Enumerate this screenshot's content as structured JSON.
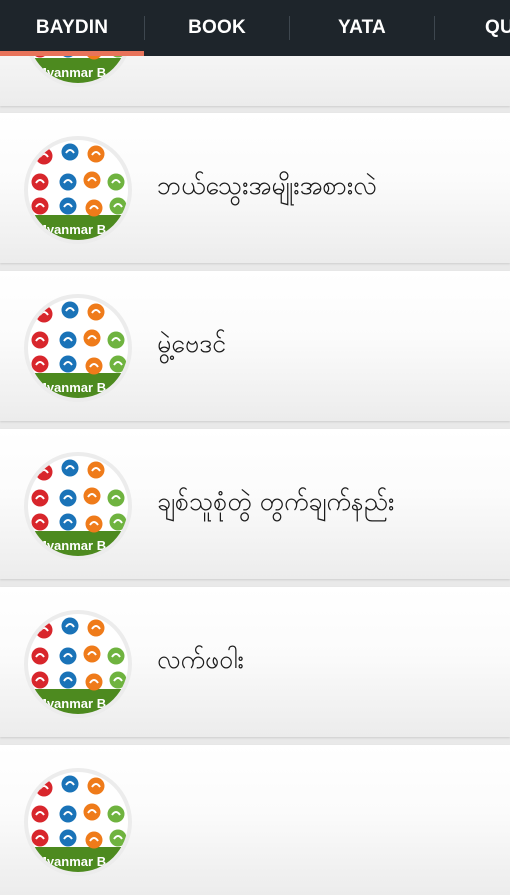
{
  "tabs": [
    {
      "label": "BAYDIN",
      "active": true
    },
    {
      "label": "BOOK",
      "active": false
    },
    {
      "label": "YATA",
      "active": false
    },
    {
      "label": "QUO",
      "active": false
    }
  ],
  "colors": {
    "tab_bar_bg": "#1e252b",
    "tab_indicator": "#e8735a",
    "zodiac_red": "#d8262c",
    "zodiac_blue": "#1a73b8",
    "zodiac_orange": "#ef7b1a",
    "zodiac_green": "#6fb33f",
    "banner_green": "#4d8a1f"
  },
  "avatar_icon": "zodiac-signs-icon",
  "avatar_banner_text": "Myanmar B",
  "items": [
    {
      "title": ""
    },
    {
      "title": "ဘယ်သွေးအမျိုးအစားလဲ"
    },
    {
      "title": "မွဲ့ဗေဒင်"
    },
    {
      "title": "ချစ်သူစုံတွဲ တွက်ချက်နည်း"
    },
    {
      "title": "လက်ဖဝါး"
    },
    {
      "title": ""
    }
  ]
}
